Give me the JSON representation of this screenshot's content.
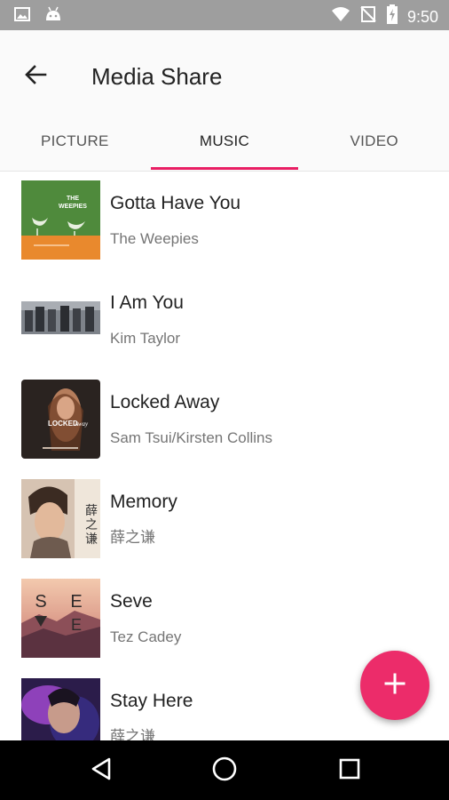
{
  "status_bar": {
    "time": "9:50",
    "icons": [
      "image-icon",
      "android-icon",
      "wifi-icon",
      "no-signal-icon",
      "battery-charging-icon"
    ]
  },
  "app_bar": {
    "title": "Media Share",
    "back_icon": "arrow-back-icon"
  },
  "tabs": [
    {
      "label": "PICTURE",
      "active": false
    },
    {
      "label": "MUSIC",
      "active": true
    },
    {
      "label": "VIDEO",
      "active": false
    }
  ],
  "songs": [
    {
      "title": "Gotta Have You",
      "artist": "The Weepies",
      "cover_text": "THE WEEPIES"
    },
    {
      "title": "I Am You",
      "artist": "Kim Taylor"
    },
    {
      "title": "Locked Away",
      "artist": "Sam Tsui/Kirsten Collins",
      "cover_text": "LOCKED AWAY"
    },
    {
      "title": "Memory",
      "artist": "薛之谦",
      "cover_text": "薛之谦"
    },
    {
      "title": "Seve",
      "artist": "Tez Cadey",
      "cover_text": "SEVE"
    },
    {
      "title": "Stay Here",
      "artist": "薛之谦"
    }
  ],
  "fab": {
    "icon": "plus-icon"
  },
  "nav_bar": {
    "icons": [
      "back-triangle-icon",
      "home-circle-icon",
      "recents-square-icon"
    ]
  },
  "colors": {
    "accent": "#e91e63",
    "fab": "#ec2c6a",
    "status_bar": "#9e9e9e",
    "nav_bar": "#000000"
  }
}
